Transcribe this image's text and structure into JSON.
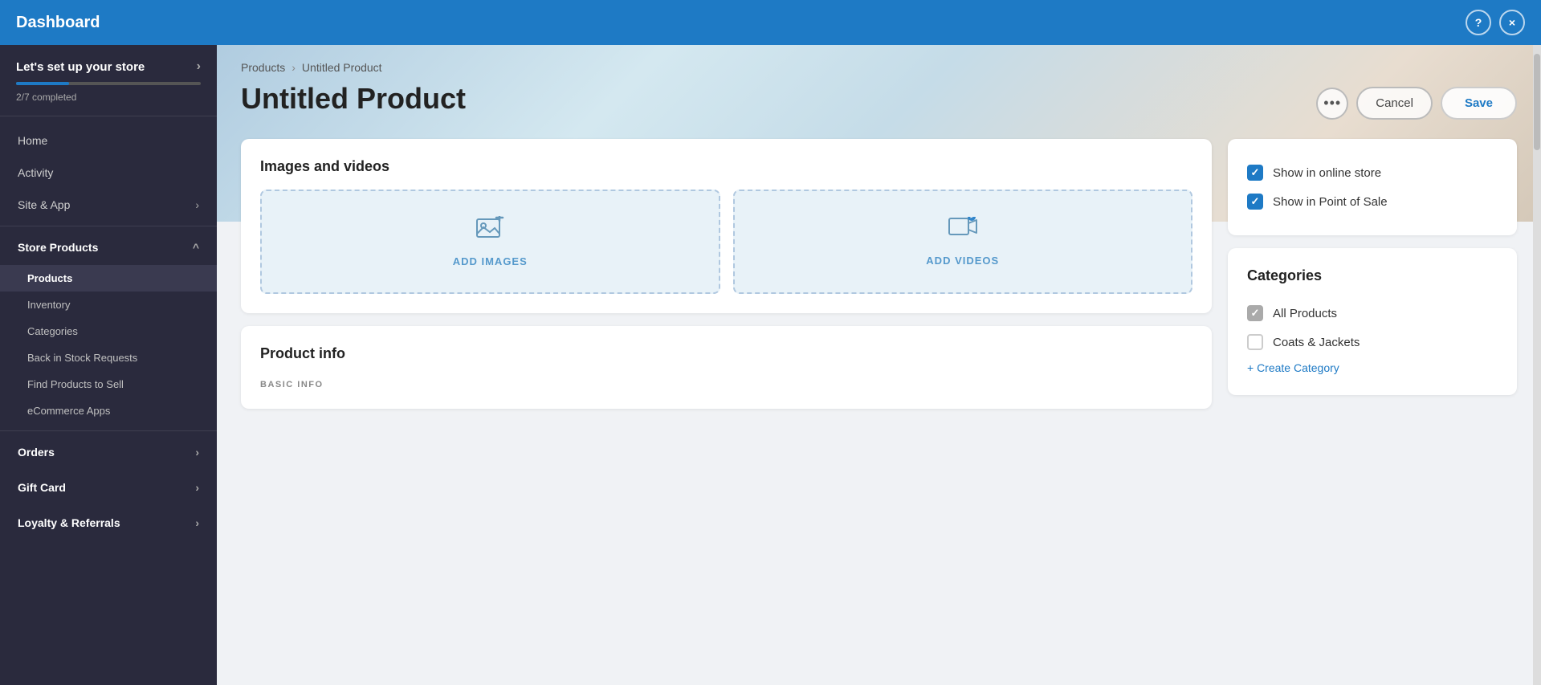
{
  "topbar": {
    "title": "Dashboard",
    "help_label": "?",
    "close_label": "×"
  },
  "sidebar": {
    "setup": {
      "title": "Let's set up your store",
      "chevron": "›",
      "progress_text": "2/7 completed"
    },
    "nav": [
      {
        "id": "home",
        "label": "Home",
        "type": "item"
      },
      {
        "id": "activity",
        "label": "Activity",
        "type": "item"
      },
      {
        "id": "site-app",
        "label": "Site & App",
        "type": "item",
        "chevron": "›"
      },
      {
        "id": "divider1",
        "type": "divider"
      },
      {
        "id": "store-products",
        "label": "Store Products",
        "type": "section",
        "chevron": "^",
        "expanded": true
      },
      {
        "id": "products",
        "label": "Products",
        "type": "subitem",
        "active": true
      },
      {
        "id": "inventory",
        "label": "Inventory",
        "type": "subitem"
      },
      {
        "id": "categories",
        "label": "Categories",
        "type": "subitem"
      },
      {
        "id": "back-stock",
        "label": "Back in Stock Requests",
        "type": "subitem"
      },
      {
        "id": "find-products",
        "label": "Find Products to Sell",
        "type": "subitem"
      },
      {
        "id": "ecommerce-apps",
        "label": "eCommerce Apps",
        "type": "subitem"
      },
      {
        "id": "divider2",
        "type": "divider"
      },
      {
        "id": "orders",
        "label": "Orders",
        "type": "item",
        "chevron": "›"
      },
      {
        "id": "gift-card",
        "label": "Gift Card",
        "type": "item",
        "chevron": "›"
      },
      {
        "id": "loyalty",
        "label": "Loyalty & Referrals",
        "type": "item",
        "chevron": "›"
      }
    ]
  },
  "breadcrumb": {
    "parent": "Products",
    "separator": "›",
    "current": "Untitled Product"
  },
  "product": {
    "title": "Untitled Product",
    "actions": {
      "dots": "•••",
      "cancel": "Cancel",
      "save": "Save"
    }
  },
  "images_section": {
    "title": "Images and videos",
    "add_images_label": "ADD IMAGES",
    "add_videos_label": "ADD VIDEOS"
  },
  "product_info_section": {
    "title": "Product info",
    "basic_info_label": "BASIC INFO"
  },
  "visibility": {
    "show_online_store": "Show in online store",
    "show_pos": "Show in Point of Sale"
  },
  "categories": {
    "title": "Categories",
    "items": [
      {
        "id": "all-products",
        "label": "All Products",
        "checked": true,
        "gray": true
      },
      {
        "id": "coats-jackets",
        "label": "Coats & Jackets",
        "checked": false
      }
    ],
    "create_link": "+ Create Category"
  }
}
